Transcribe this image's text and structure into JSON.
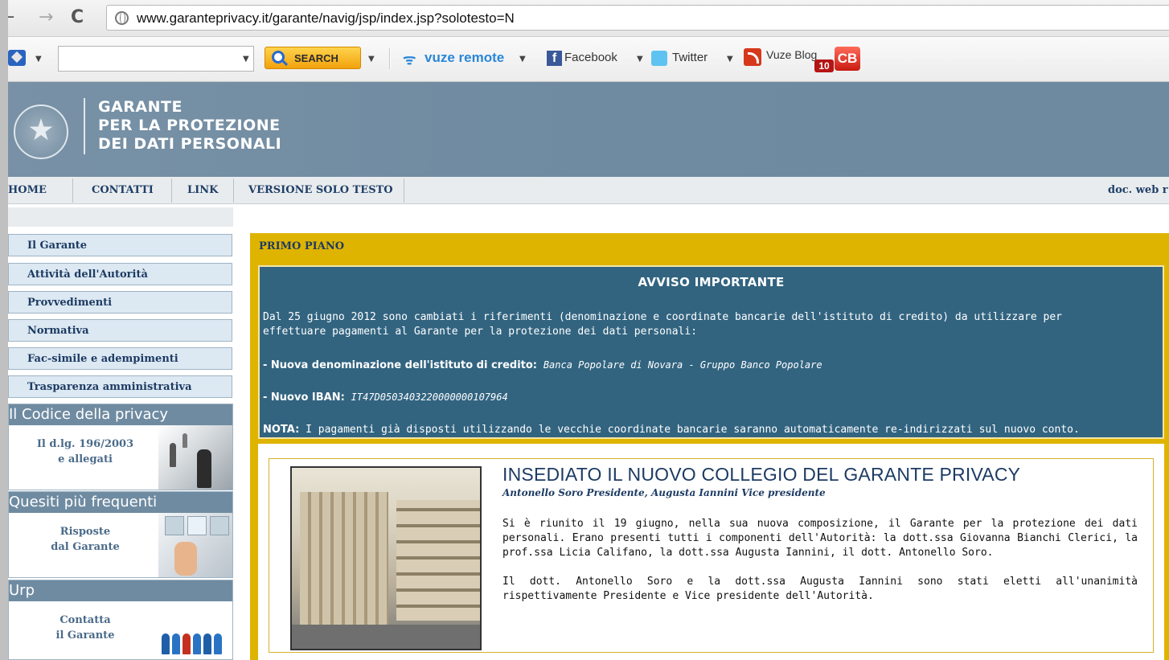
{
  "browser": {
    "url": "www.garanteprivacy.it/garante/navig/jsp/index.jsp?solotesto=N"
  },
  "toolbar": {
    "search_label": "SEARCH",
    "vuze_label": "vuze remote",
    "facebook_label": "Facebook",
    "twitter_label": "Twitter",
    "vuze_blog_label": "Vuze Blog",
    "badge_count": "10",
    "cb_label": "CB"
  },
  "header": {
    "title_lines": [
      "GARANTE",
      "PER LA PROTEZIONE",
      "DEI DATI PERSONALI"
    ]
  },
  "nav": {
    "items": [
      "HOME",
      "CONTATTI",
      "LINK",
      "VERSIONE SOLO TESTO"
    ],
    "right_text": "doc. web r"
  },
  "sidebar": {
    "items": [
      "Il Garante",
      "Attività dell'Autorità",
      "Provvedimenti",
      "Normativa",
      "Fac-simile e adempimenti",
      "Trasparenza amministrativa"
    ],
    "boxes": [
      {
        "title": "Il Codice della privacy",
        "text_lines": [
          "Il d.lg. 196/2003",
          "e allegati"
        ]
      },
      {
        "title": "Quesiti più frequenti",
        "text_lines": [
          "Risposte",
          "dal Garante"
        ]
      },
      {
        "title": "Urp",
        "text_lines": [
          "Contatta",
          "il Garante"
        ]
      }
    ]
  },
  "main": {
    "section_label": "PRIMO PIANO",
    "notice": {
      "title": "AVVISO IMPORTANTE",
      "para_line1": "Dal 25 giugno 2012 sono cambiati i riferimenti (denominazione e coordinate bancarie dell'istituto di credito) da utilizzare per",
      "para_line2": "effettuare pagamenti al Garante per la protezione dei dati personali:",
      "denom_label": "- Nuova denominazione dell'istituto di credito:",
      "denom_value": "Banca Popolare di Novara - Gruppo Banco Popolare",
      "iban_label": "- Nuovo IBAN:",
      "iban_value": "IT47D0503403220000000107964",
      "nota_label": "NOTA:",
      "nota_text": "I pagamenti già disposti utilizzando le vecchie coordinate bancarie saranno automaticamente re-indirizzati sul nuovo conto."
    },
    "news": {
      "title": "INSEDIATO IL NUOVO COLLEGIO DEL GARANTE PRIVACY",
      "subtitle": "Antonello Soro Presidente, Augusta Iannini Vice presidente",
      "para1": "Si è riunito il 19 giugno, nella sua nuova composizione, il Garante per la protezione dei dati personali. Erano presenti tutti i componenti dell'Autorità: la dott.ssa Giovanna Bianchi Clerici, la prof.ssa Licia Califano, la dott.ssa Augusta Iannini, il dott. Antonello Soro.",
      "para2": "Il dott. Antonello Soro e la dott.ssa Augusta Iannini sono stati eletti all'unanimità rispettivamente Presidente e Vice presidente dell'Autorità."
    }
  }
}
